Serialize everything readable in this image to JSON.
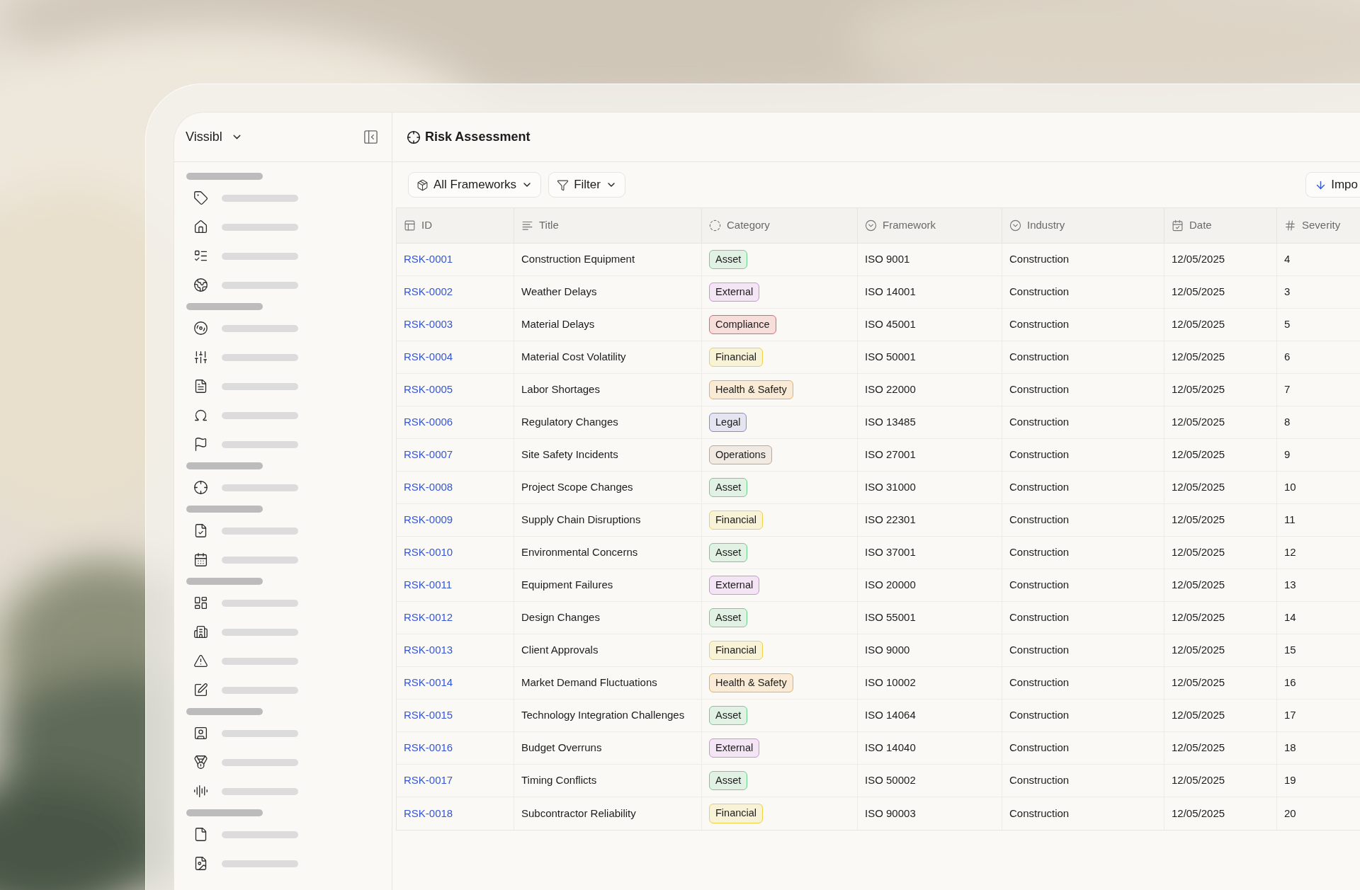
{
  "workspace": {
    "name": "Vissibl"
  },
  "page": {
    "title": "Risk Assessment"
  },
  "toolbar": {
    "buttons": [
      {
        "label": "All Frameworks",
        "kind": "frameworks"
      },
      {
        "label": "Filter",
        "kind": "filter"
      }
    ],
    "import": {
      "label": "Impo"
    }
  },
  "table": {
    "columns": [
      {
        "label": "ID",
        "kind": "id"
      },
      {
        "label": "Title",
        "kind": "text"
      },
      {
        "label": "Category",
        "kind": "badge"
      },
      {
        "label": "Framework",
        "kind": "select"
      },
      {
        "label": "Industry",
        "kind": "select"
      },
      {
        "label": "Date",
        "kind": "date"
      },
      {
        "label": "Severity",
        "kind": "number"
      }
    ],
    "rows": [
      {
        "id": "RSK-0001",
        "title": "Construction Equipment",
        "category": {
          "label": "Asset",
          "color": "#6fcf8f"
        },
        "framework": "ISO 9001",
        "industry": "Construction",
        "date": "12/05/2025",
        "severity": "4"
      },
      {
        "id": "RSK-0002",
        "title": "Weather Delays",
        "category": {
          "label": "External",
          "color": "#d58be8"
        },
        "framework": "ISO 14001",
        "industry": "Construction",
        "date": "12/05/2025",
        "severity": "3"
      },
      {
        "id": "RSK-0003",
        "title": "Material Delays",
        "category": {
          "label": "Compliance",
          "color": "#e86464"
        },
        "framework": "ISO 45001",
        "industry": "Construction",
        "date": "12/05/2025",
        "severity": "5"
      },
      {
        "id": "RSK-0004",
        "title": "Material Cost Volatility",
        "category": {
          "label": "Financial",
          "color": "#f0d048"
        },
        "framework": "ISO 50001",
        "industry": "Construction",
        "date": "12/05/2025",
        "severity": "6"
      },
      {
        "id": "RSK-0005",
        "title": "Labor Shortages",
        "category": {
          "label": "Health & Safety",
          "color": "#f2ad45"
        },
        "framework": "ISO 22000",
        "industry": "Construction",
        "date": "12/05/2025",
        "severity": "7"
      },
      {
        "id": "RSK-0006",
        "title": "Regulatory Changes",
        "category": {
          "label": "Legal",
          "color": "#8488df"
        },
        "framework": "ISO 13485",
        "industry": "Construction",
        "date": "12/05/2025",
        "severity": "8"
      },
      {
        "id": "RSK-0007",
        "title": "Site Safety Incidents",
        "category": {
          "label": "Operations",
          "color": "#c4a58a"
        },
        "framework": "ISO 27001",
        "industry": "Construction",
        "date": "12/05/2025",
        "severity": "9"
      },
      {
        "id": "RSK-0008",
        "title": "Project Scope Changes",
        "category": {
          "label": "Asset",
          "color": "#6fcf8f"
        },
        "framework": "ISO 31000",
        "industry": "Construction",
        "date": "12/05/2025",
        "severity": "10"
      },
      {
        "id": "RSK-0009",
        "title": "Supply Chain Disruptions",
        "category": {
          "label": "Financial",
          "color": "#f0d048"
        },
        "framework": "ISO 22301",
        "industry": "Construction",
        "date": "12/05/2025",
        "severity": "11"
      },
      {
        "id": "RSK-0010",
        "title": "Environmental Concerns",
        "category": {
          "label": "Asset",
          "color": "#6fcf8f"
        },
        "framework": "ISO 37001",
        "industry": "Construction",
        "date": "12/05/2025",
        "severity": "12"
      },
      {
        "id": "RSK-0011",
        "title": "Equipment Failures",
        "category": {
          "label": "External",
          "color": "#d58be8"
        },
        "framework": "ISO 20000",
        "industry": "Construction",
        "date": "12/05/2025",
        "severity": "13"
      },
      {
        "id": "RSK-0012",
        "title": "Design Changes",
        "category": {
          "label": "Asset",
          "color": "#6fcf8f"
        },
        "framework": "ISO 55001",
        "industry": "Construction",
        "date": "12/05/2025",
        "severity": "14"
      },
      {
        "id": "RSK-0013",
        "title": "Client Approvals",
        "category": {
          "label": "Financial",
          "color": "#f0d048"
        },
        "framework": "ISO 9000",
        "industry": "Construction",
        "date": "12/05/2025",
        "severity": "15"
      },
      {
        "id": "RSK-0014",
        "title": "Market Demand Fluctuations",
        "category": {
          "label": "Health & Safety",
          "color": "#f2ad45"
        },
        "framework": "ISO 10002",
        "industry": "Construction",
        "date": "12/05/2025",
        "severity": "16"
      },
      {
        "id": "RSK-0015",
        "title": "Technology Integration Challenges",
        "category": {
          "label": "Asset",
          "color": "#6fcf8f"
        },
        "framework": "ISO 14064",
        "industry": "Construction",
        "date": "12/05/2025",
        "severity": "17"
      },
      {
        "id": "RSK-0016",
        "title": "Budget Overruns",
        "category": {
          "label": "External",
          "color": "#d58be8"
        },
        "framework": "ISO 14040",
        "industry": "Construction",
        "date": "12/05/2025",
        "severity": "18"
      },
      {
        "id": "RSK-0017",
        "title": "Timing Conflicts",
        "category": {
          "label": "Asset",
          "color": "#6fcf8f"
        },
        "framework": "ISO 50002",
        "industry": "Construction",
        "date": "12/05/2025",
        "severity": "19"
      },
      {
        "id": "RSK-0018",
        "title": "Subcontractor Reliability",
        "category": {
          "label": "Financial",
          "color": "#f0d048"
        },
        "framework": "ISO 90003",
        "industry": "Construction",
        "date": "12/05/2025",
        "severity": "20"
      }
    ]
  }
}
